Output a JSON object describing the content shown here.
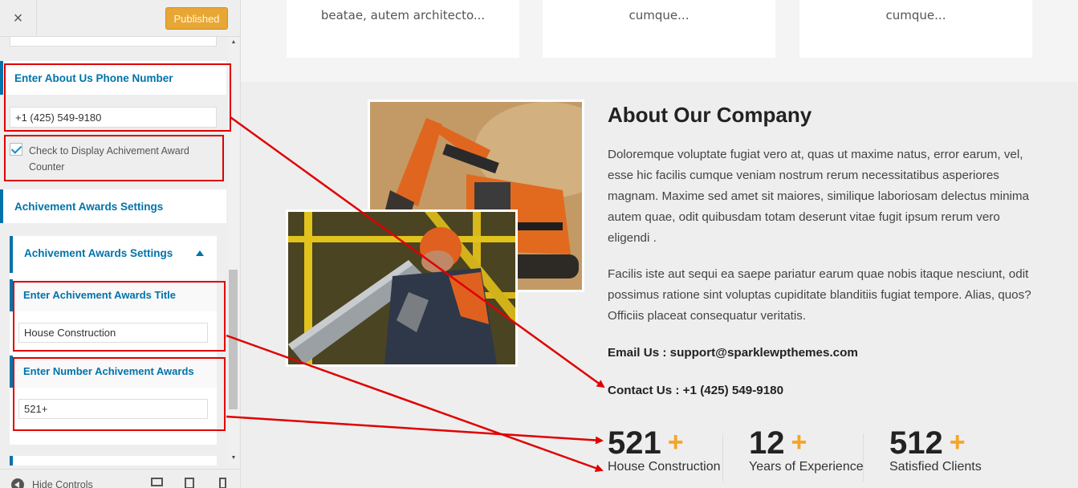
{
  "sidebar": {
    "close_label": "×",
    "publish_label": "Published",
    "phone_section_title": "Enter About Us Phone Number",
    "phone_value": "+1 (425) 549-9180",
    "achievement_checkbox_label": "Check to Display Achivement Award Counter",
    "awards_section_title": "Achivement Awards Settings",
    "awards_panel_title": "Achivement Awards Settings",
    "awards_title_label": "Enter Achivement Awards Title",
    "awards_title_value": "House Construction",
    "awards_number_label": "Enter Number Achivement Awards",
    "awards_number_value": "521+",
    "footer_hide_label": "Hide Controls"
  },
  "preview": {
    "cards": [
      {
        "text": "beatae, autem architecto..."
      },
      {
        "text": "cumque..."
      },
      {
        "text": "cumque..."
      }
    ],
    "about_title": "About Our Company",
    "about_para_1": "Doloremque voluptate fugiat vero at, quas ut maxime natus, error earum, vel, esse hic facilis cumque veniam nostrum rerum necessitatibus asperiores magnam. Maxime sed amet sit maiores, similique laboriosam delectus minima autem quae, odit quibusdam totam deserunt vitae fugit ipsum rerum vero eligendi .",
    "about_para_2": "Facilis iste aut sequi ea saepe pariatur earum quae nobis itaque nesciunt, odit possimus ratione sint voluptas cupiditate blanditiis fugiat tempore. Alias, quos? Officiis placeat consequatur veritatis.",
    "email_line": "Email Us : support@sparklewpthemes.com",
    "contact_line": "Contact Us : +1 (425) 549-9180",
    "stats": [
      {
        "number": "521",
        "plus": "+",
        "label": "House Construction"
      },
      {
        "number": "12",
        "plus": "+",
        "label": "Years of Experience"
      },
      {
        "number": "512",
        "plus": "+",
        "label": "Satisfied Clients"
      }
    ]
  },
  "colors": {
    "accent_blue": "#0073aa",
    "publish_orange": "#e8a734",
    "plus_orange": "#f5a623",
    "annotation_red": "#e00000"
  }
}
